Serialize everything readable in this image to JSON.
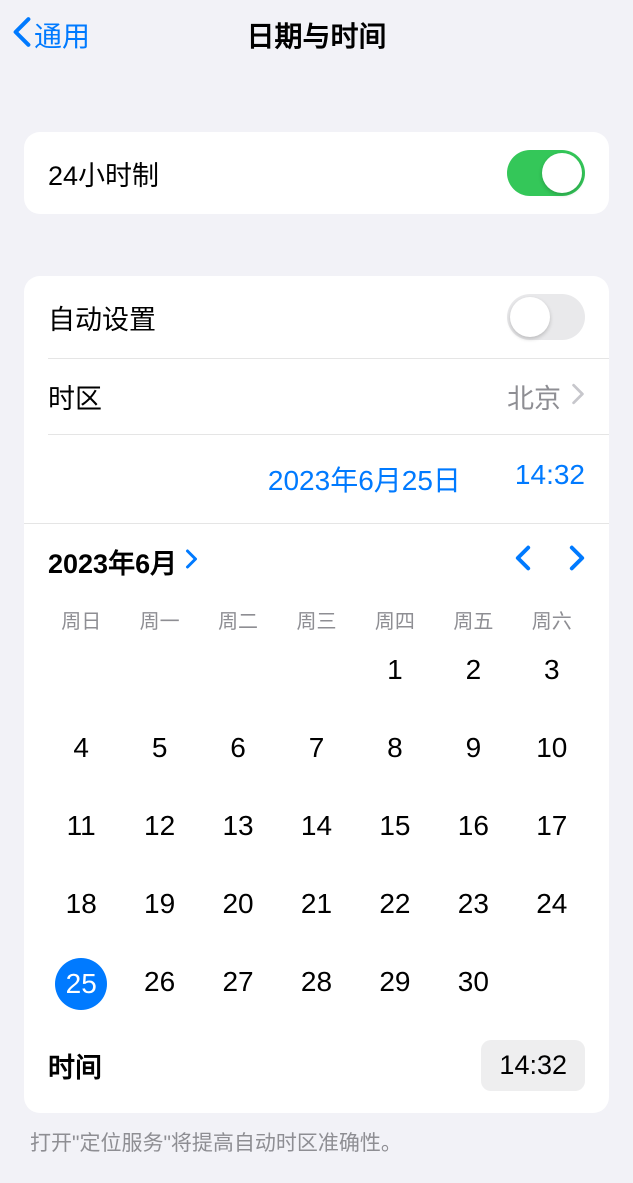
{
  "header": {
    "back_label": "通用",
    "title": "日期与时间"
  },
  "settings": {
    "format24h_label": "24小时制",
    "auto_set_label": "自动设置",
    "timezone_label": "时区",
    "timezone_value": "北京"
  },
  "picker": {
    "date_display": "2023年6月25日",
    "time_display": "14:32",
    "month_label": "2023年6月",
    "weekdays": [
      "周日",
      "周一",
      "周二",
      "周三",
      "周四",
      "周五",
      "周六"
    ],
    "leading_blanks": 4,
    "days": [
      1,
      2,
      3,
      4,
      5,
      6,
      7,
      8,
      9,
      10,
      11,
      12,
      13,
      14,
      15,
      16,
      17,
      18,
      19,
      20,
      21,
      22,
      23,
      24,
      25,
      26,
      27,
      28,
      29,
      30
    ],
    "selected_day": 25,
    "time_label": "时间",
    "time_value": "14:32"
  },
  "footer": {
    "note": "打开\"定位服务\"将提高自动时区准确性。"
  }
}
